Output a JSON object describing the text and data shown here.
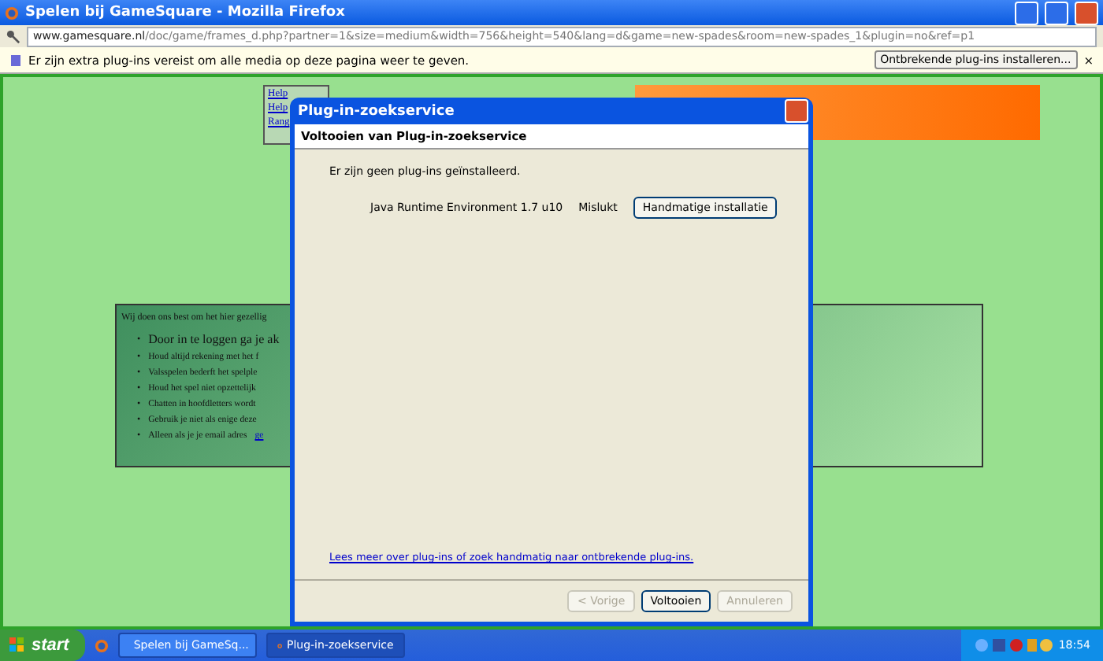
{
  "window": {
    "title": "Spelen bij GameSquare - Mozilla Firefox"
  },
  "address_bar": {
    "domain": "www.gamesquare.nl",
    "path": "/doc/game/frames_d.php?partner=1&size=medium&width=756&height=540&lang=d&game=new-spades&room=new-spades_1&plugin=no&ref=p1"
  },
  "notification_bar": {
    "message": "Er zijn extra plug-ins vereist om alle media op deze pagina weer te geven.",
    "button": "Ontbrekende plug-ins installeren...",
    "close": "×"
  },
  "page": {
    "help_links": [
      "Help",
      "Help",
      "Rang"
    ],
    "info_box": {
      "intro": "Wij doen ons best om het hier gezellig",
      "bullets": [
        {
          "marker": "•",
          "text": "Door in te loggen ga je ak",
          "large": true
        },
        {
          "marker": "•",
          "text": "Houd altijd rekening met het f",
          "large": false
        },
        {
          "marker": "•",
          "text": "Valsspelen bederft het spelple",
          "large": false
        },
        {
          "marker": "•",
          "text": "Houd het spel niet opzettelijk",
          "large": false
        },
        {
          "marker": "•",
          "text": "Chatten in hoofdletters wordt",
          "large": false
        },
        {
          "marker": "•",
          "text": "Gebruik je niet als enige deze",
          "large": false
        },
        {
          "marker": "•",
          "text": "Alleen als je je email adres",
          "large": false,
          "link": "ge"
        }
      ]
    }
  },
  "dialog": {
    "title": "Plug-in-zoekservice",
    "heading": "Voltooien van Plug-in-zoekservice",
    "message": "Er zijn geen plug-ins geïnstalleerd.",
    "plugins": [
      {
        "name": "Java Runtime Environment 1.7 u10",
        "status": "Mislukt",
        "action": "Handmatige installatie"
      }
    ],
    "link": "Lees meer over plug-ins of zoek handmatig naar ontbrekende plug-ins.",
    "buttons": [
      {
        "label": "< Vorige",
        "disabled": true
      },
      {
        "label": "Voltooien",
        "disabled": false
      },
      {
        "label": "Annuleren",
        "disabled": true
      }
    ]
  },
  "taskbar": {
    "start": "start",
    "tasks": [
      {
        "label": "Spelen bij GameSq...",
        "selected": false
      },
      {
        "label": "Plug-in-zoekservice",
        "selected": true
      }
    ],
    "clock": "18:54"
  }
}
